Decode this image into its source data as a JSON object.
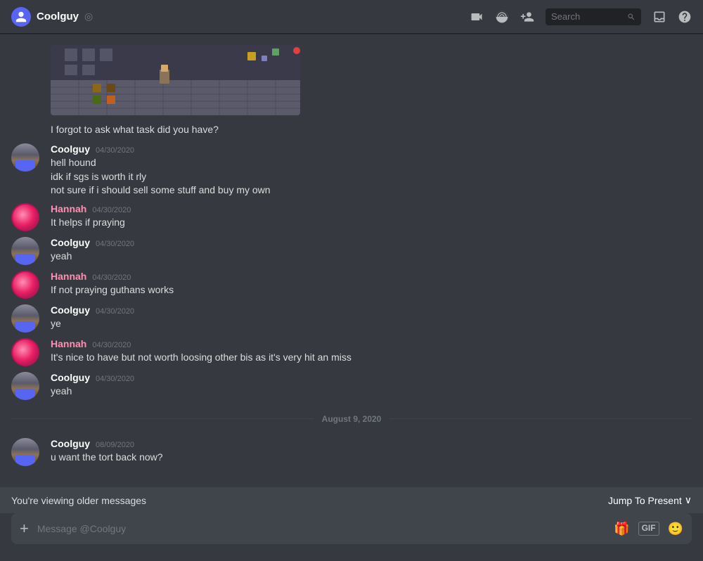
{
  "header": {
    "title": "Coolguy",
    "status_icon": "◎",
    "icons": [
      "📵",
      "📹",
      "⭐",
      "👤",
      "🖥",
      "❓"
    ],
    "search_placeholder": "Search"
  },
  "chat": {
    "forgotten_message": "I forgot to ask what task did you have?",
    "messages": [
      {
        "id": "msg1",
        "author": "Coolguy",
        "author_type": "coolguy",
        "timestamp": "04/30/2020",
        "lines": [
          "hell hound",
          "idk if sgs is worth it rly",
          "not sure if i should sell some stuff and buy my own"
        ]
      },
      {
        "id": "msg2",
        "author": "Hannah",
        "author_type": "hannah",
        "timestamp": "04/30/2020",
        "lines": [
          "It helps if praying"
        ]
      },
      {
        "id": "msg3",
        "author": "Coolguy",
        "author_type": "coolguy",
        "timestamp": "04/30/2020",
        "lines": [
          "yeah"
        ]
      },
      {
        "id": "msg4",
        "author": "Hannah",
        "author_type": "hannah",
        "timestamp": "04/30/2020",
        "lines": [
          "If not praying guthans works"
        ]
      },
      {
        "id": "msg5",
        "author": "Coolguy",
        "author_type": "coolguy",
        "timestamp": "04/30/2020",
        "lines": [
          "ye"
        ]
      },
      {
        "id": "msg6",
        "author": "Hannah",
        "author_type": "hannah",
        "timestamp": "04/30/2020",
        "lines": [
          "It's nice to have but not worth loosing other bis as it's very hit an miss"
        ]
      },
      {
        "id": "msg7",
        "author": "Coolguy",
        "author_type": "coolguy",
        "timestamp": "04/30/2020",
        "lines": [
          "yeah"
        ]
      }
    ],
    "date_divider": "August 9, 2020",
    "new_messages": [
      {
        "id": "msg8",
        "author": "Coolguy",
        "author_type": "coolguy",
        "timestamp": "08/09/2020",
        "lines": [
          "u want the tort back now?"
        ]
      }
    ]
  },
  "banner": {
    "text": "You're viewing older messages",
    "jump_label": "Jump To Present",
    "chevron": "∨"
  },
  "input": {
    "placeholder": "Message @Coolguy",
    "add_icon": "+",
    "gift_icon": "🎁",
    "gif_label": "GIF",
    "emoji_icon": "🙂"
  }
}
